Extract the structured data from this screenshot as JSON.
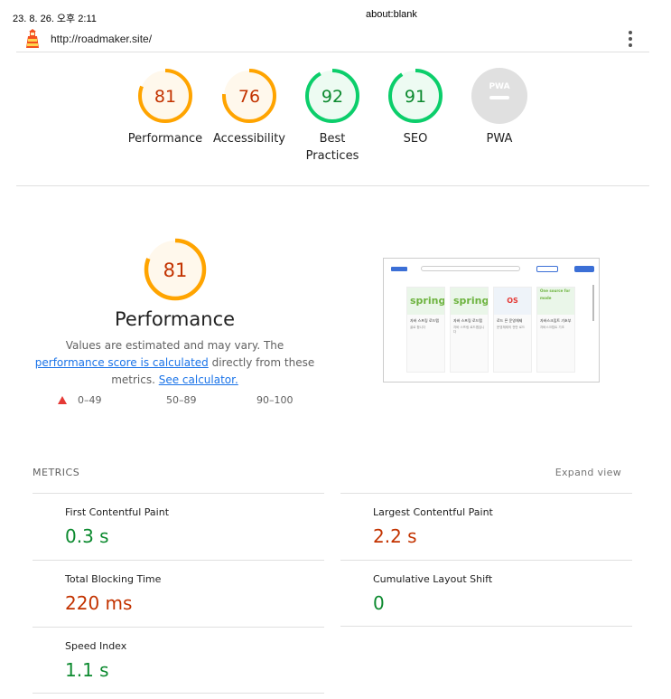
{
  "print_header": {
    "date": "23. 8. 26. 오후 2:11",
    "title": "about:blank"
  },
  "topbar": {
    "url": "http://roadmaker.site/",
    "logo_icon": "lighthouse-icon",
    "menu_icon": "kebab-menu-icon"
  },
  "categories": [
    {
      "id": "performance",
      "score": "81",
      "score_value": 81,
      "label": "Performance",
      "color": "#c33300",
      "ring": "#ffa400",
      "fill": "#fff8ec"
    },
    {
      "id": "accessibility",
      "score": "76",
      "score_value": 76,
      "label": "Accessibility",
      "color": "#c33300",
      "ring": "#ffa400",
      "fill": "#fff8ec"
    },
    {
      "id": "best-practices",
      "score": "92",
      "score_value": 92,
      "label": "Best Practices",
      "color": "#0c8a2f",
      "ring": "#0cce6b",
      "fill": "#edfbf2"
    },
    {
      "id": "seo",
      "score": "91",
      "score_value": 91,
      "label": "SEO",
      "color": "#0c8a2f",
      "ring": "#0cce6b",
      "fill": "#edfbf2"
    },
    {
      "id": "pwa",
      "score": "",
      "label": "PWA",
      "badge_text": "PWA",
      "color": "#9e9e9e"
    }
  ],
  "performance": {
    "score": "81",
    "score_value": 81,
    "title": "Performance",
    "desc_prefix": "Values are estimated and may vary. The ",
    "desc_link1": "performance score is calculated",
    "desc_mid": " directly from these metrics. ",
    "desc_link2": "See calculator."
  },
  "legend": {
    "fail": "0–49",
    "average": "50–89",
    "pass": "90–100"
  },
  "screenshot": {
    "cards": [
      {
        "img": "spring",
        "title": "자바 스프링 로드맵",
        "sub": "골로 합니다"
      },
      {
        "img": "spring",
        "title": "자바 스프링 로드맵",
        "sub": "자바 스프링 로드맵입니다"
      },
      {
        "img": "OS",
        "title": "로드 픈 운영체제",
        "sub": "운영체제의 전반 로드"
      },
      {
        "img": "One source for mode",
        "title": "자바스크립트 기초부",
        "sub": "자바스크립트 기초"
      }
    ]
  },
  "metrics": {
    "header": "METRICS",
    "expand": "Expand view",
    "items": [
      {
        "name": "First Contentful Paint",
        "value": "0.3 s",
        "status": "pass"
      },
      {
        "name": "Largest Contentful Paint",
        "value": "2.2 s",
        "status": "average"
      },
      {
        "name": "Total Blocking Time",
        "value": "220 ms",
        "status": "average"
      },
      {
        "name": "Cumulative Layout Shift",
        "value": "0",
        "status": "pass"
      },
      {
        "name": "Speed Index",
        "value": "1.1 s",
        "status": "pass"
      }
    ]
  }
}
